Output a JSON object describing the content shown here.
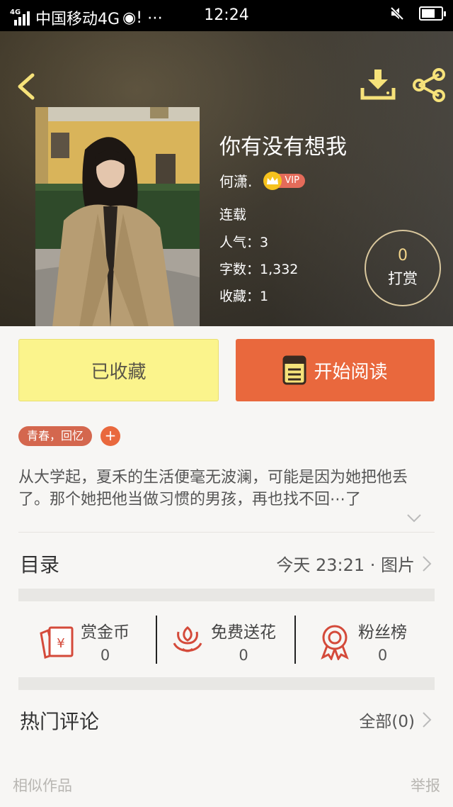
{
  "status_bar": {
    "network": "4G",
    "carrier": "中国移动4G",
    "time": "12:24"
  },
  "book": {
    "title": "你有没有想我",
    "author": "何潇.",
    "vip_label": "VIP",
    "status": "连载",
    "popularity": "人气：3",
    "word_count": "字数：1,332",
    "favorites": "收藏：1",
    "tip_count": "0",
    "tip_label": "打赏",
    "summary": "从大学起，夏禾的生活便毫无波澜，可能是因为她把他丢了。那个她把他当做习惯的男孩，再也找不回⋯了"
  },
  "actions": {
    "collected_label": "已收藏",
    "read_label": "开始阅读"
  },
  "tags": {
    "tag_label": "青春，回忆",
    "add_label": "+"
  },
  "toc": {
    "title": "目录",
    "update_info": "今天 23:21 · 图片"
  },
  "features": {
    "reward": {
      "label": "赏金币",
      "count": "0"
    },
    "flower": {
      "label": "免费送花",
      "count": "0"
    },
    "fans": {
      "label": "粉丝榜",
      "count": "0"
    }
  },
  "comments": {
    "title": "热门评论",
    "all_label": "全部(0)"
  },
  "footer": {
    "similar": "相似作品",
    "report": "举报"
  },
  "colors": {
    "accent_orange": "#e9683d",
    "collected_yellow": "#fbf48c",
    "icon_yellow": "#f6e27a",
    "icon_red": "#d44a3a"
  },
  "icons": [
    "back-arrow-icon",
    "download-icon",
    "share-icon",
    "crown-icon",
    "book-icon",
    "red-envelope-icon",
    "flower-icon",
    "medal-icon",
    "chevron-right-icon",
    "chevron-down-icon",
    "battery-icon",
    "mute-icon"
  ]
}
